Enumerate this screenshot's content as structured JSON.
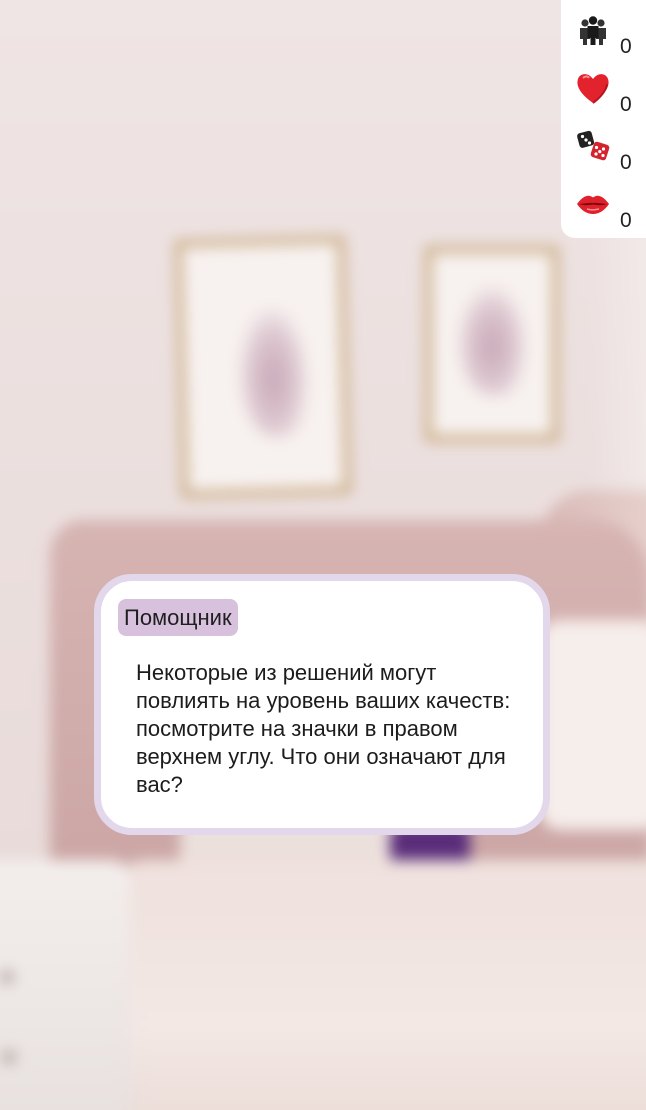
{
  "stats": [
    {
      "icon": "people-icon",
      "value": "0"
    },
    {
      "icon": "heart-icon",
      "value": "0"
    },
    {
      "icon": "dice-icon",
      "value": "0"
    },
    {
      "icon": "lips-icon",
      "value": "0"
    }
  ],
  "dialog": {
    "speaker": "Помощник",
    "text": "Некоторые из решений могут повлиять на уровень ваших качеств: посмотрите на значки в правом верхнем углу. Что они означают для вас?"
  }
}
